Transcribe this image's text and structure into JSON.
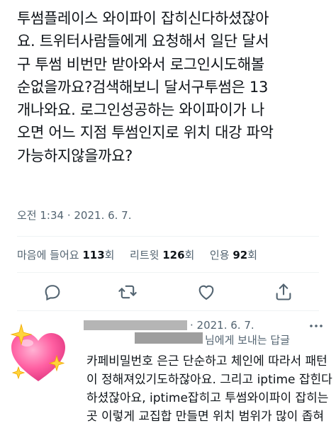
{
  "tweet": {
    "lines": [
      "투썸플레이스 와이파이 잡히신다하셨잖아",
      "요. 트위터사람들에게 요청해서 일단 달서",
      "구 투썸 비번만 받아와서 로그인시도해볼",
      "순없을까요?검색해보니 달서구투썸은 13",
      "개나와요. 로그인성공하는 와이파이가 나",
      "오면 어느 지점 투썸인지로 위치 대강 파악",
      "가능하지않을까요?"
    ],
    "time": "오전 1:34",
    "date": "2021. 6. 7."
  },
  "stats": {
    "likes_label": "마음에 들어요",
    "likes_count": "113",
    "likes_unit": "회",
    "retweets_label": "리트윗",
    "retweets_count": "126",
    "retweets_unit": "회",
    "quotes_label": "인용",
    "quotes_count": "92",
    "quotes_unit": "회"
  },
  "actions": {
    "icons": [
      "reply-icon",
      "retweet-icon",
      "like-icon",
      "share-icon"
    ]
  },
  "reply": {
    "date": "· 2021. 6. 7.",
    "to_label": "님에게 보내는 답글",
    "lines": [
      "카페비밀번호 은근 단순하고 체인에 따라서 패턴",
      "이 정해져있기도하잖아요. 그리고 iptime 잡힌다",
      "하셨잖아요, iptime잡히고 투썸와이파이 잡히는",
      "곳 이렇게 교집합 만들면 위치 범위가 많이 좁혀"
    ]
  },
  "colors": {
    "text": "#0f1419",
    "muted": "#536471",
    "divider": "#eff3f4",
    "heart_pink": "#ff5fa2",
    "sparkle_yellow": "#ffd43b"
  }
}
